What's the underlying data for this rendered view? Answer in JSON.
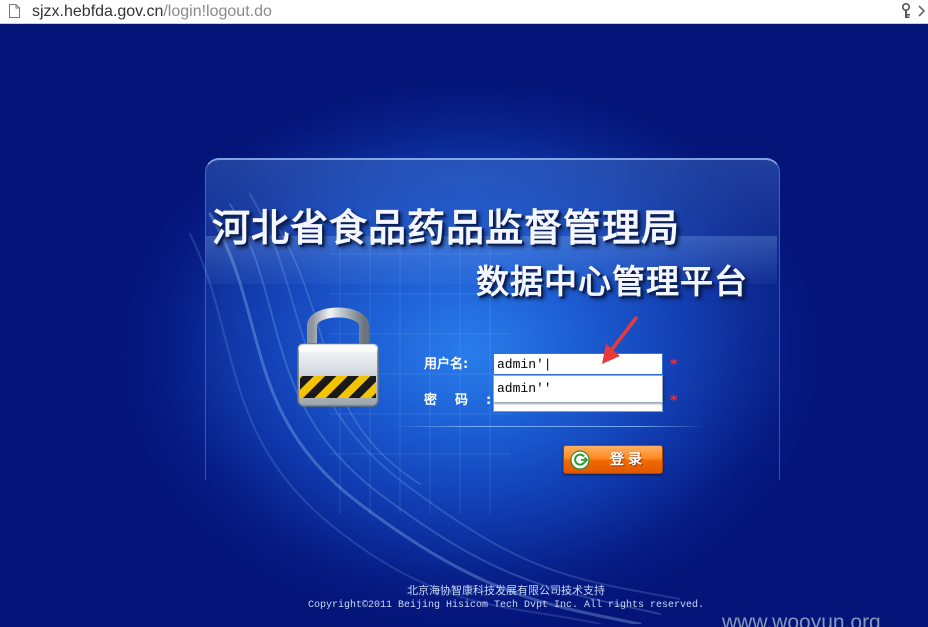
{
  "browser": {
    "url_host": "sjzx.hebfda.gov.cn",
    "url_path": "/login!logout.do"
  },
  "page": {
    "title_main": "河北省食品药品监督管理局",
    "title_sub": "数据中心管理平台"
  },
  "login_form": {
    "username_label": "用户名:",
    "password_label_chars": "密码",
    "password_label_colon": ":",
    "username_value": "admin'|",
    "password_value": "",
    "autocomplete_suggestion": "admin''",
    "required_mark": "*",
    "login_button_label": "登录"
  },
  "footer": {
    "support_text": "北京海协智康科技发展有限公司技术支持",
    "copyright_text": "Copyright©2011 Beijing Hisicom Tech Dvpt Inc. All rights reserved."
  },
  "watermark": "www.wooyun.org",
  "colors": {
    "background_deep": "#061c86",
    "background_center": "#1d6fe0",
    "required_star": "#ff2a2a",
    "button_orange": "#ff8a20",
    "arrow_red": "#e83a3a"
  },
  "icons": {
    "page": "page-icon",
    "key": "key-icon",
    "lock": "padlock-icon",
    "login": "power-arrow-icon",
    "annotation": "red-arrow-icon"
  }
}
